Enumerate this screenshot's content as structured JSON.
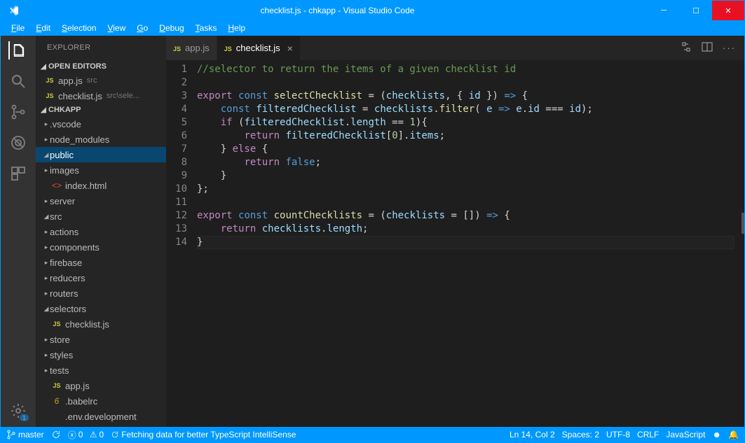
{
  "window": {
    "title": "checklist.js - chkapp - Visual Studio Code"
  },
  "menu": [
    "File",
    "Edit",
    "Selection",
    "View",
    "Go",
    "Debug",
    "Tasks",
    "Help"
  ],
  "activity": {
    "gear_badge": "1"
  },
  "sidebar": {
    "title": "EXPLORER",
    "open_editors_label": "OPEN EDITORS",
    "workspace_label": "CHKAPP",
    "open_editors": [
      {
        "icon": "js",
        "name": "app.js",
        "hint": "src"
      },
      {
        "icon": "js",
        "name": "checklist.js",
        "hint": "src\\sele..."
      }
    ],
    "tree": [
      {
        "d": 0,
        "t": "folder",
        "c": "closed",
        "name": ".vscode"
      },
      {
        "d": 0,
        "t": "folder",
        "c": "closed",
        "name": "node_modules"
      },
      {
        "d": 0,
        "t": "folder",
        "c": "open",
        "name": "public",
        "sel": true
      },
      {
        "d": 1,
        "t": "folder",
        "c": "closed",
        "name": "images"
      },
      {
        "d": 1,
        "t": "file",
        "icon": "html",
        "name": "index.html"
      },
      {
        "d": 0,
        "t": "folder",
        "c": "closed",
        "name": "server"
      },
      {
        "d": 0,
        "t": "folder",
        "c": "open",
        "name": "src"
      },
      {
        "d": 1,
        "t": "folder",
        "c": "closed",
        "name": "actions"
      },
      {
        "d": 1,
        "t": "folder",
        "c": "closed",
        "name": "components"
      },
      {
        "d": 1,
        "t": "folder",
        "c": "closed",
        "name": "firebase"
      },
      {
        "d": 1,
        "t": "folder",
        "c": "closed",
        "name": "reducers"
      },
      {
        "d": 1,
        "t": "folder",
        "c": "closed",
        "name": "routers"
      },
      {
        "d": 1,
        "t": "folder",
        "c": "open",
        "name": "selectors"
      },
      {
        "d": 2,
        "t": "file",
        "icon": "js",
        "name": "checklist.js"
      },
      {
        "d": 1,
        "t": "folder",
        "c": "closed",
        "name": "store"
      },
      {
        "d": 1,
        "t": "folder",
        "c": "closed",
        "name": "styles"
      },
      {
        "d": 1,
        "t": "folder",
        "c": "closed",
        "name": "tests"
      },
      {
        "d": 1,
        "t": "file",
        "icon": "js",
        "name": "app.js"
      },
      {
        "d": 0,
        "t": "file",
        "icon": "babel",
        "name": ".babelrc"
      },
      {
        "d": 0,
        "t": "file",
        "icon": "",
        "name": ".env.development"
      }
    ]
  },
  "tabs": [
    {
      "icon": "js",
      "name": "app.js",
      "active": false
    },
    {
      "icon": "js",
      "name": "checklist.js",
      "active": true,
      "close": true
    }
  ],
  "code": {
    "lines": [
      [
        [
          "c-comment",
          "//selector to return the items of a given checklist id"
        ]
      ],
      [],
      [
        [
          "c-kw",
          "export"
        ],
        [
          "c-punc",
          " "
        ],
        [
          "c-kw2",
          "const"
        ],
        [
          "c-punc",
          " "
        ],
        [
          "c-fn",
          "selectChecklist"
        ],
        [
          "c-punc",
          " = ("
        ],
        [
          "c-var",
          "checklists"
        ],
        [
          "c-punc",
          ", { "
        ],
        [
          "c-var",
          "id"
        ],
        [
          "c-punc",
          " }) "
        ],
        [
          "c-kw2",
          "=>"
        ],
        [
          "c-punc",
          " {"
        ]
      ],
      [
        [
          "c-punc",
          "    "
        ],
        [
          "c-kw2",
          "const"
        ],
        [
          "c-punc",
          " "
        ],
        [
          "c-var",
          "filteredChecklist"
        ],
        [
          "c-punc",
          " = "
        ],
        [
          "c-var",
          "checklists"
        ],
        [
          "c-punc",
          "."
        ],
        [
          "c-fn",
          "filter"
        ],
        [
          "c-punc",
          "( "
        ],
        [
          "c-var",
          "e"
        ],
        [
          "c-punc",
          " "
        ],
        [
          "c-kw2",
          "=>"
        ],
        [
          "c-punc",
          " "
        ],
        [
          "c-var",
          "e"
        ],
        [
          "c-punc",
          "."
        ],
        [
          "c-var",
          "id"
        ],
        [
          "c-punc",
          " === "
        ],
        [
          "c-var",
          "id"
        ],
        [
          "c-punc",
          ");"
        ]
      ],
      [
        [
          "c-punc",
          "    "
        ],
        [
          "c-kw",
          "if"
        ],
        [
          "c-punc",
          " ("
        ],
        [
          "c-var",
          "filteredChecklist"
        ],
        [
          "c-punc",
          "."
        ],
        [
          "c-var",
          "length"
        ],
        [
          "c-punc",
          " == "
        ],
        [
          "c-num",
          "1"
        ],
        [
          "c-punc",
          "){"
        ]
      ],
      [
        [
          "c-punc",
          "        "
        ],
        [
          "c-kw",
          "return"
        ],
        [
          "c-punc",
          " "
        ],
        [
          "c-var",
          "filteredChecklist"
        ],
        [
          "c-punc",
          "["
        ],
        [
          "c-num",
          "0"
        ],
        [
          "c-punc",
          "]."
        ],
        [
          "c-var",
          "items"
        ],
        [
          "c-punc",
          ";"
        ]
      ],
      [
        [
          "c-punc",
          "    } "
        ],
        [
          "c-kw",
          "else"
        ],
        [
          "c-punc",
          " {"
        ]
      ],
      [
        [
          "c-punc",
          "        "
        ],
        [
          "c-kw",
          "return"
        ],
        [
          "c-punc",
          " "
        ],
        [
          "c-kw2",
          "false"
        ],
        [
          "c-punc",
          ";"
        ]
      ],
      [
        [
          "c-punc",
          "    }"
        ]
      ],
      [
        [
          "c-punc",
          "};"
        ]
      ],
      [],
      [
        [
          "c-kw",
          "export"
        ],
        [
          "c-punc",
          " "
        ],
        [
          "c-kw2",
          "const"
        ],
        [
          "c-punc",
          " "
        ],
        [
          "c-fn",
          "countChecklists"
        ],
        [
          "c-punc",
          " = ("
        ],
        [
          "c-var",
          "checklists"
        ],
        [
          "c-punc",
          " = []) "
        ],
        [
          "c-kw2",
          "=>"
        ],
        [
          "c-punc",
          " {"
        ]
      ],
      [
        [
          "c-punc",
          "    "
        ],
        [
          "c-kw",
          "return"
        ],
        [
          "c-punc",
          " "
        ],
        [
          "c-var",
          "checklists"
        ],
        [
          "c-punc",
          "."
        ],
        [
          "c-var",
          "length"
        ],
        [
          "c-punc",
          ";"
        ]
      ],
      [
        [
          "c-punc",
          "}"
        ]
      ]
    ],
    "active_line": 14
  },
  "status": {
    "branch": "master",
    "errors": "0",
    "warnings": "0",
    "msg": "Fetching data for better TypeScript IntelliSense",
    "pos": "Ln 14, Col 2",
    "spaces": "Spaces: 2",
    "enc": "UTF-8",
    "eol": "CRLF",
    "lang": "JavaScript"
  }
}
